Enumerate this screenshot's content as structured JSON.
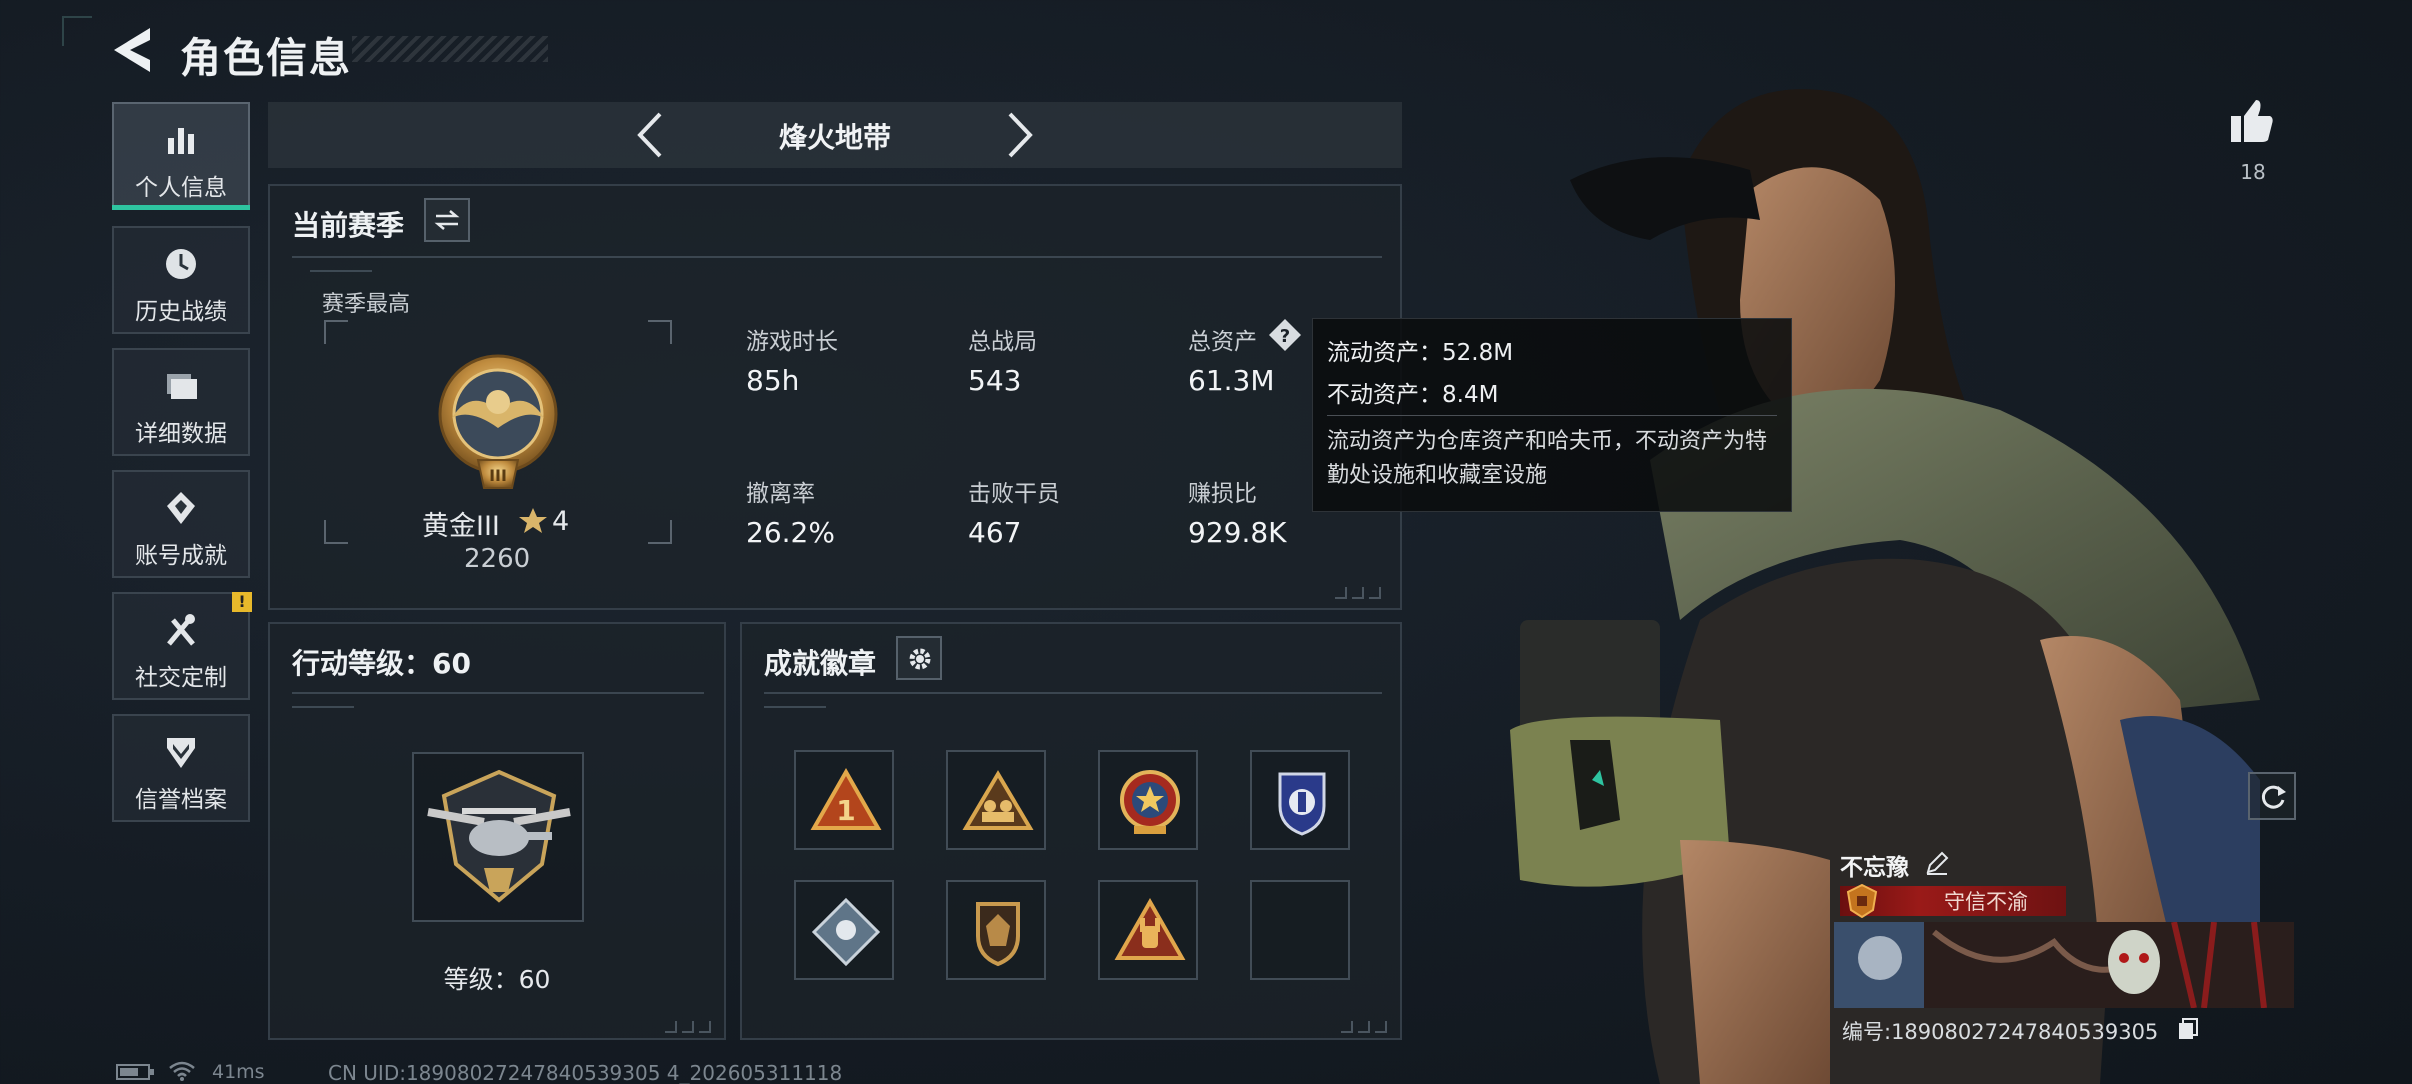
{
  "header": {
    "title": "角色信息"
  },
  "sidebar": {
    "items": [
      {
        "label": "个人信息",
        "icon": "bar-chart-icon"
      },
      {
        "label": "历史战绩",
        "icon": "clock-icon"
      },
      {
        "label": "详细数据",
        "icon": "folder-icon"
      },
      {
        "label": "账号成就",
        "icon": "medal-icon"
      },
      {
        "label": "社交定制",
        "icon": "tools-icon",
        "badge": "!"
      },
      {
        "label": "信誉档案",
        "icon": "shield-chevron-icon"
      }
    ]
  },
  "mode": {
    "name": "烽火地带"
  },
  "season": {
    "title": "当前赛季",
    "best_label": "赛季最高",
    "rank_name": "黄金III",
    "rank_stars": "4",
    "rank_points": "2260",
    "stats": [
      {
        "label": "游戏时长",
        "value": "85h"
      },
      {
        "label": "总战局",
        "value": "543"
      },
      {
        "label": "总资产",
        "value": "61.3M"
      },
      {
        "label": "撤离率",
        "value": "26.2%"
      },
      {
        "label": "击败干员",
        "value": "467"
      },
      {
        "label": "赚损比",
        "value": "929.8K"
      }
    ]
  },
  "tooltip": {
    "liquid": "流动资产：52.8M",
    "fixed": "不动资产：8.4M",
    "note": "流动资产为仓库资产和哈夫币，不动资产为特勤处设施和收藏室设施"
  },
  "action_level": {
    "title": "行动等级：60",
    "level_text": "等级：60"
  },
  "badges": {
    "title": "成就徽章",
    "items": [
      "rank-one-badge",
      "team-badge",
      "star-emblem-badge",
      "police-badge",
      "diamond-badge",
      "shield-face-badge",
      "hand-sign-badge",
      "empty-slot"
    ]
  },
  "character": {
    "likes": "18",
    "player_name": "不忘豫",
    "player_title": "守信不渝",
    "serial": "编号:18908027247840539305"
  },
  "status_bar": {
    "ping": "41ms",
    "uid": "CN UID:18908027247840539305 4_202605311118"
  },
  "colors": {
    "accent": "#2ec4a0",
    "gold": "#c79a45",
    "warn": "#e8b92b",
    "title_red": "#9a1a18"
  }
}
